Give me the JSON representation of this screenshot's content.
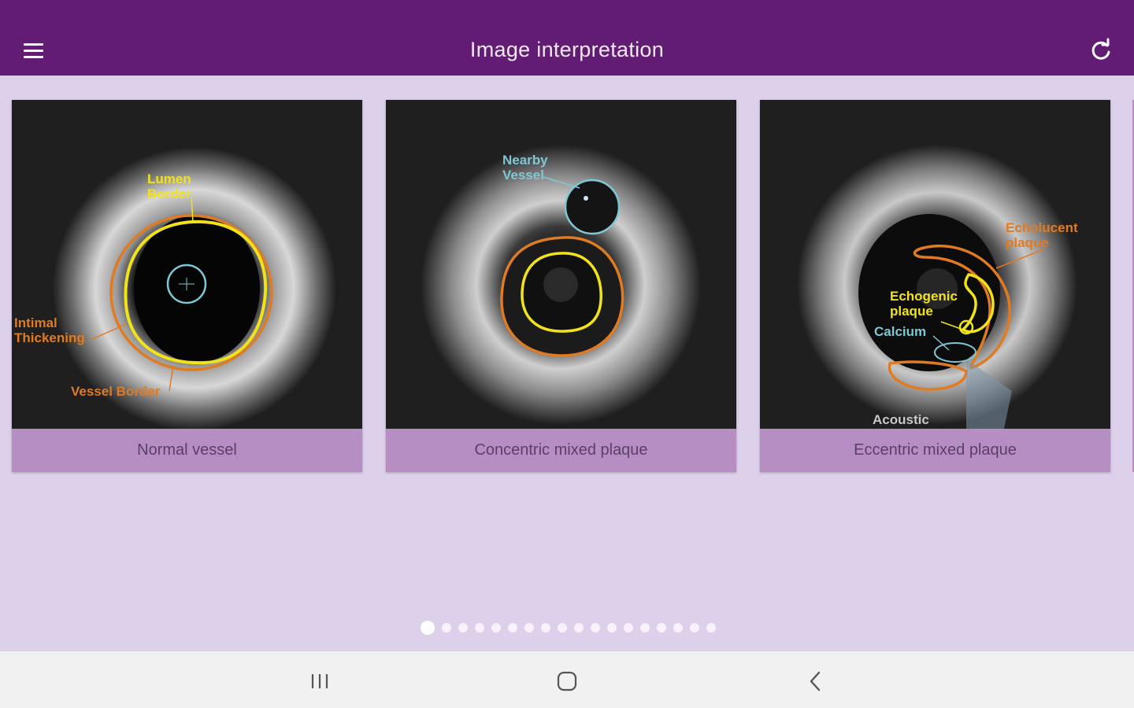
{
  "appbar": {
    "title": "Image interpretation",
    "menu_icon": "hamburger-menu-icon",
    "refresh_icon": "refresh-icon"
  },
  "cards": [
    {
      "caption": "Normal vessel",
      "labels": {
        "lumen": [
          "Lumen",
          "Border"
        ],
        "intimal": [
          "Intimal",
          "Thickening"
        ],
        "vessel": "Vessel Border"
      }
    },
    {
      "caption": "Concentric mixed plaque",
      "labels": {
        "nearby": [
          "Nearby",
          "Vessel"
        ]
      }
    },
    {
      "caption": "Eccentric mixed plaque",
      "labels": {
        "echolucent": [
          "Echolucent",
          "plaque"
        ],
        "echogenic": [
          "Echogenic",
          "plaque"
        ],
        "calcium": "Calcium",
        "acoustic": "Acoustic"
      }
    }
  ],
  "pagination": {
    "total": 18,
    "active": 0
  },
  "colors": {
    "appbar": "#621c73",
    "background": "#ddd0ea",
    "caption": "#b68ec4",
    "lumen_yellow": "#f2e21a",
    "vessel_orange": "#e07b22",
    "nearby_cyan": "#7fc7d4"
  },
  "navbar": {
    "recents_icon": "recent-apps-icon",
    "home_icon": "home-icon",
    "back_icon": "back-icon"
  }
}
